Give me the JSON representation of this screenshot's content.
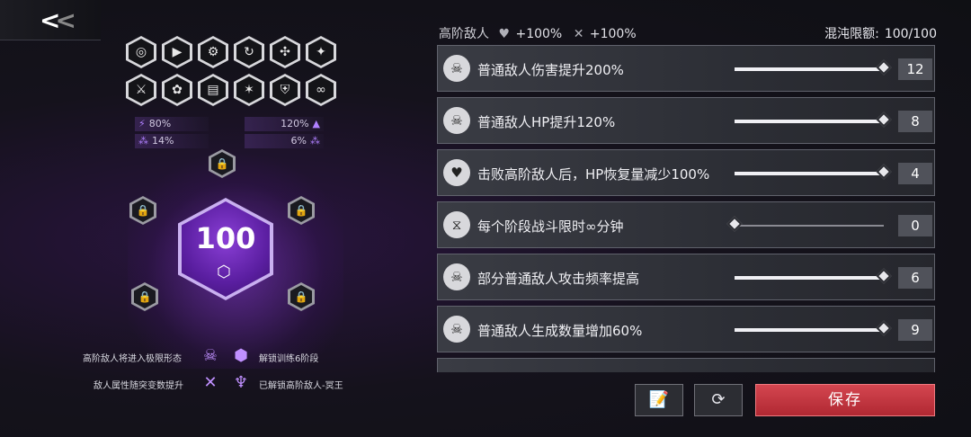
{
  "nav": {
    "back_icon": "double-chevron-left-icon"
  },
  "top_icons": [
    "spiral-icon",
    "play-icon",
    "gear-cluster-icon",
    "cycle-icon",
    "nodes-icon",
    "sparkle-icon",
    "crossed-swords-icon",
    "flower-icon",
    "bars-icon",
    "burst-icon",
    "shield-badge-icon",
    "infinity-icon"
  ],
  "stats": {
    "left_top": "80%",
    "left_bottom": "14%",
    "right_top": "120%",
    "right_bottom": "6%"
  },
  "core": {
    "value": "100",
    "logo_icon": "cube-logo-icon"
  },
  "buffs": [
    {
      "text": "高阶敌人将进入极限形态",
      "icon": "demon-face-icon"
    },
    {
      "text": "解锁训练6阶段",
      "icon": "hex-c-icon"
    },
    {
      "text": "敌人属性随突变数提升",
      "icon": "arrows-cross-icon"
    },
    {
      "text": "已解锁高阶敌人-冥王",
      "icon": "hooded-figure-icon"
    }
  ],
  "header": {
    "label": "高阶敌人",
    "bonus1": "+100%",
    "bonus2": "+100%",
    "chaos_label": "混沌限额:",
    "chaos_value": "100/100"
  },
  "modifiers": [
    {
      "label": "普通敌人伤害提升200%",
      "value": "12",
      "level": 1.0,
      "icon": "skull-badge-icon"
    },
    {
      "label": "普通敌人HP提升120%",
      "value": "8",
      "level": 1.0,
      "icon": "skull-badge-icon"
    },
    {
      "label": "击败高阶敌人后，HP恢复量减少100%",
      "value": "4",
      "level": 1.0,
      "icon": "heart-down-icon"
    },
    {
      "label": "每个阶段战斗限时∞分钟",
      "value": "0",
      "level": 0.0,
      "icon": "hourglass-icon"
    },
    {
      "label": "部分普通敌人攻击频率提高",
      "value": "6",
      "level": 1.0,
      "icon": "skull-badge-icon"
    },
    {
      "label": "普通敌人生成数量增加60%",
      "value": "9",
      "level": 1.0,
      "icon": "skull-badge-icon"
    }
  ],
  "actions": {
    "notes_icon": "notes-question-icon",
    "reset_icon": "refresh-icon",
    "save_label": "保存"
  }
}
